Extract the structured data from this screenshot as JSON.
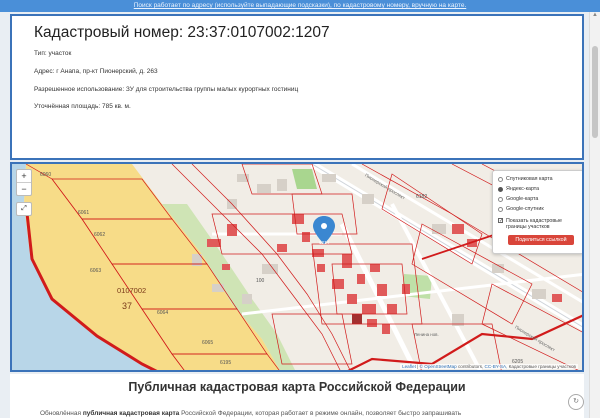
{
  "top_notice": "Поиск работает по адресу (используйте выпадающие подсказки), по кадастровому номеру, вручную на карте.",
  "info": {
    "title": "Кадастровый номер: 23:37:0107002:1207",
    "type_line": "Тип: участок",
    "address_line": "Адрес: г Анапа, пр-кт Пионерский, д. 263",
    "permitted_use_line": "Разрешенное использование: ЗУ для строительства группы малых курортных гостиниц",
    "area_line": "Уточнённая площадь: 785 кв. м."
  },
  "map": {
    "zoom_in": "+",
    "zoom_out": "−",
    "fullscreen_icon": "fullscreen-icon",
    "layers": [
      {
        "label": "Спутниковая карта",
        "selected": false
      },
      {
        "label": "Яндекс-карта",
        "selected": true
      },
      {
        "label": "Google-карта",
        "selected": false
      },
      {
        "label": "Google-спутник",
        "selected": false
      }
    ],
    "show_boundaries_label": "Показать кадастровые границы участков",
    "show_boundaries_checked": true,
    "share_button": "Поделиться ссылкой",
    "attribution_leaflet": "Leaflet",
    "attribution_osm": "© OpenStreetMap",
    "attribution_contrib": "contributors,",
    "attribution_license": "CC-BY-SA,",
    "attribution_source": "Кадастровые границы участков",
    "labels": {
      "quarter": "0107002",
      "district": "37",
      "plot": "6214",
      "street": "Пионерский проспект",
      "street2": "Пионерский проспект",
      "park": "Ленина нов.",
      "n1": "6060",
      "n2": "6061",
      "n3": "6062",
      "n4": "6063",
      "n5": "6064",
      "n6": "6065",
      "n7": "6195",
      "n8": "6182",
      "n9": "6205",
      "n10": "100"
    },
    "colors": {
      "beach": "#f7dc88",
      "water": "#b8d6e8",
      "boundary": "#d11b1b",
      "buildings": "#e05a5a",
      "marker": "#3a87d1"
    }
  },
  "footer": {
    "heading": "Публичная кадастровая карта Российской Федерации",
    "text_prefix": "Обновлённая ",
    "text_bold": "публичная кадастровая карта",
    "text_rest": " Российской Федерации, которая работает в режиме онлайн, позволяет быстро запрашивать"
  }
}
